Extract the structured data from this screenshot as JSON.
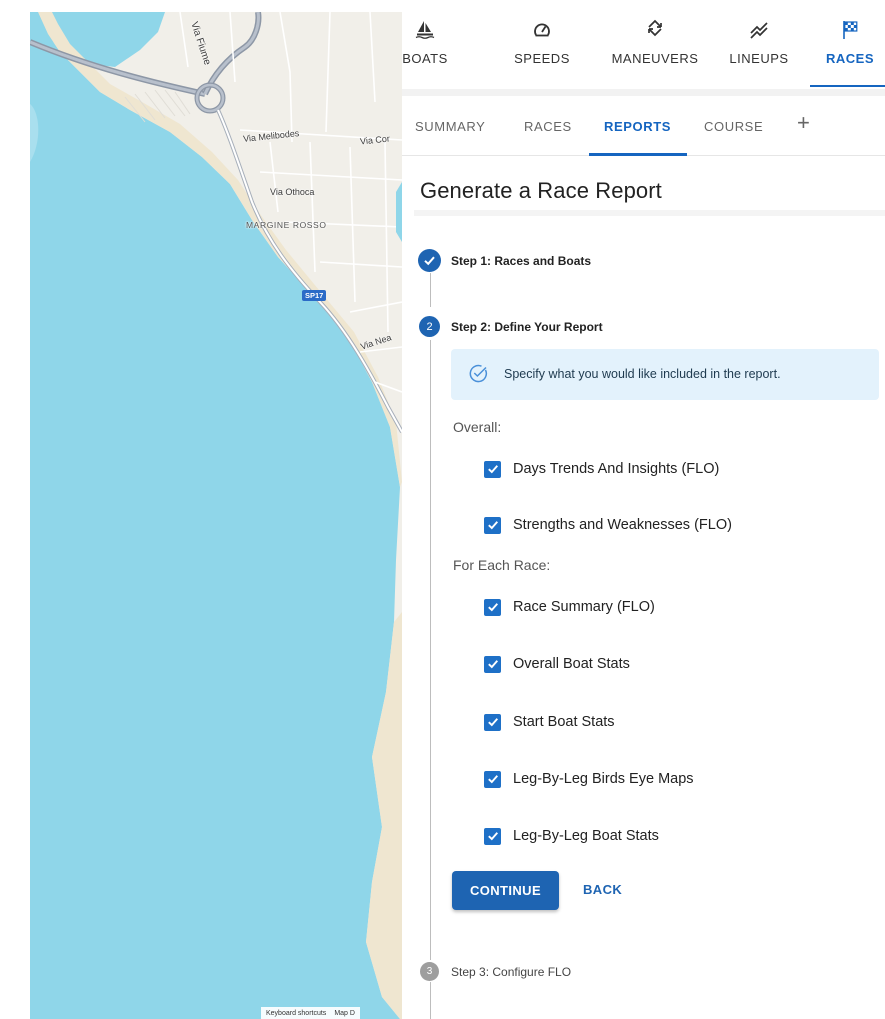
{
  "map": {
    "labels": {
      "via_fiume": "Via Fiume",
      "via_melibodes": "Via Melibodes",
      "via_cor": "Via Cor",
      "via_othoca": "Via Othoca",
      "margine_rosso": "MARGINE ROSSO",
      "via_nea": "Via Nea",
      "sp17": "SP17"
    },
    "footer": {
      "shortcuts": "Keyboard shortcuts",
      "mapdata": "Map D"
    },
    "colors": {
      "sea": "#8fd6e9",
      "land": "#f1efe9",
      "beach": "#efe6d0",
      "road": "#8d97a6"
    }
  },
  "topnav": {
    "tabs": [
      {
        "label": "BOATS",
        "icon": "sailboat-icon"
      },
      {
        "label": "SPEEDS",
        "icon": "speedometer-icon"
      },
      {
        "label": "MANEUVERS",
        "icon": "tack-arrows-icon"
      },
      {
        "label": "LINEUPS",
        "icon": "trend-lines-icon"
      },
      {
        "label": "RACES",
        "icon": "checkered-flag-icon"
      }
    ],
    "active": "RACES"
  },
  "subnav": {
    "tabs": [
      "SUMMARY",
      "RACES",
      "REPORTS",
      "COURSE"
    ],
    "active": "REPORTS",
    "add_label": "+"
  },
  "page": {
    "title": "Generate a Race Report"
  },
  "stepper": {
    "step1": {
      "number": "1",
      "label": "Step 1: Races and Boats",
      "status": "complete"
    },
    "step2": {
      "number": "2",
      "label": "Step 2: Define Your Report",
      "status": "active"
    },
    "step3": {
      "number": "3",
      "label": "Step 3: Configure FLO",
      "status": "pending"
    }
  },
  "info": {
    "text": "Specify what you would like included in the report."
  },
  "overall": {
    "heading": "Overall:",
    "options": [
      {
        "label": "Days Trends And Insights (FLO)",
        "checked": true
      },
      {
        "label": "Strengths and Weaknesses (FLO)",
        "checked": true
      }
    ]
  },
  "each_race": {
    "heading": "For Each Race:",
    "options": [
      {
        "label": "Race Summary (FLO)",
        "checked": true
      },
      {
        "label": "Overall Boat Stats",
        "checked": true
      },
      {
        "label": "Start Boat Stats",
        "checked": true
      },
      {
        "label": "Leg-By-Leg Birds Eye Maps",
        "checked": true
      },
      {
        "label": "Leg-By-Leg Boat Stats",
        "checked": true
      }
    ]
  },
  "actions": {
    "continue_label": "CONTINUE",
    "back_label": "BACK"
  },
  "colors": {
    "primary": "#1565c0",
    "checkbox": "#1e70c7",
    "info_bg": "#e3f2fc",
    "pending": "#9e9e9e"
  }
}
